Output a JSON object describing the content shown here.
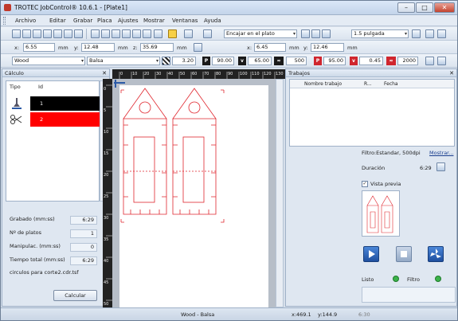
{
  "window": {
    "title": "TROTEC JobControl® 10.6.1 - [Plate1]"
  },
  "menu": [
    "Archivo",
    "Editar",
    "Grabar",
    "Placa",
    "Ajustes",
    "Mostrar",
    "Ventanas",
    "Ayuda"
  ],
  "toolbar1": {
    "fit_select": "Encajar en el plato",
    "grid_select": "1.5 pulgada"
  },
  "toolbar2": {
    "x_label": "x:",
    "x_value": "6.55",
    "y_label": "y:",
    "y_value": "12.48",
    "unit": "mm",
    "z_label": "z:",
    "z_value": "35.69",
    "x2_value": "6.45",
    "y2_value": "12.46"
  },
  "toolbar3": {
    "material": "Wood",
    "submaterial": "Balsa",
    "thickness": "3.20",
    "power_icon": "P",
    "power": "90.00",
    "velocity_icon": "v",
    "velocity": "65.00",
    "freq": "500",
    "power2_icon": "P",
    "power2": "95.00",
    "velocity2_icon": "v",
    "velocity2": "0.45",
    "freq2": "2000"
  },
  "left_panel": {
    "title": "Cálculo",
    "col_tipo": "Tipo",
    "col_id": "Id",
    "rows": [
      {
        "id": "1",
        "color": "#000000"
      },
      {
        "id": "2",
        "color": "#ff0000"
      }
    ],
    "stats": [
      {
        "label": "Grabado (mm:ss)",
        "value": "6:29"
      },
      {
        "label": "Nº de platos",
        "value": "1"
      },
      {
        "label": "Manipulac. (mm:ss)",
        "value": "0"
      },
      {
        "label": "Tiempo total (mm:ss)",
        "value": "6:29"
      }
    ],
    "filename": "circulos para corte2.cdr.tsf",
    "calc_button": "Calcular"
  },
  "ruler": {
    "top": [
      "0",
      "10",
      "20",
      "30",
      "40",
      "50",
      "60",
      "70",
      "80",
      "90",
      "100",
      "110",
      "120",
      "130"
    ],
    "left": [
      "0",
      "",
      "",
      "",
      "",
      "",
      "",
      "",
      "",
      "",
      "",
      "",
      "",
      "",
      "",
      "",
      "",
      "",
      "",
      "",
      "",
      "",
      "",
      "",
      "",
      "",
      "",
      "",
      "",
      "",
      "",
      "",
      "",
      "",
      "",
      "",
      "",
      "",
      "",
      "",
      "",
      "",
      "",
      "",
      "",
      "",
      "",
      "",
      "",
      "",
      "",
      "",
      "",
      "",
      "",
      "",
      "",
      "",
      "",
      "",
      "",
      "",
      "",
      "",
      "",
      "",
      "",
      "",
      "",
      "",
      "",
      "",
      "",
      "",
      "",
      "",
      "",
      "",
      "",
      "",
      "",
      "",
      "",
      "",
      "",
      "",
      "",
      "",
      "",
      "",
      "",
      "",
      "",
      "",
      "",
      "",
      "",
      "",
      "",
      "",
      "",
      "",
      "",
      "",
      "",
      "",
      "",
      "",
      "",
      ""
    ],
    "left_labels": [
      "0",
      "5",
      "10",
      "15",
      "20",
      "25",
      "30",
      "35",
      "40",
      "45",
      "50"
    ]
  },
  "right_panel": {
    "title": "Trabajos",
    "col_name": "Nombre trabajo",
    "col_r": "R...",
    "col_date": "Fecha",
    "filter": "Filtro:Estandar, 500dpi",
    "show_link": "Mostrar...",
    "duration_label": "Duración",
    "duration": "6:29",
    "preview_label": "Vista previa",
    "ready_label": "Listo",
    "filter_label": "Filtro"
  },
  "status": {
    "center": "Wood - Balsa",
    "coords_x": "x:469.1",
    "coords_y": "y:144.9",
    "time": "6:30"
  },
  "colors": {
    "red": "#d0262e",
    "accent": "#2b5aa6",
    "green": "#3bb24a"
  },
  "icons": [
    "app-logo-icon",
    "new-icon",
    "open-icon",
    "save-icon",
    "print-icon",
    "zoom-in-icon",
    "zoom-out-icon",
    "play-icon",
    "stop-icon",
    "fan-icon",
    "scissors-icon",
    "engrave-icon"
  ]
}
